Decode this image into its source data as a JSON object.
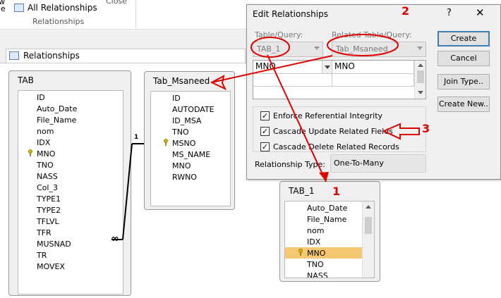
{
  "ribbon": {
    "frag1": "w",
    "frag2": "le",
    "all_relationships": "All Relationships",
    "group": "Relationships",
    "close": "Close"
  },
  "doc_tab": {
    "title": "Relationships"
  },
  "tables": {
    "tab": {
      "title": "TAB",
      "fields": [
        "ID",
        "Auto_Date",
        "File_Name",
        "nom",
        "IDX",
        "MNO",
        "TNO",
        "NASS",
        "Col_3",
        "TYPE1",
        "TYPE2",
        "TFLVL",
        "TFR",
        "MUSNAD",
        "TR",
        "MOVEX"
      ],
      "key_field": "MNO"
    },
    "tab_msaneed": {
      "title": "Tab_Msaneed",
      "fields": [
        "ID",
        "AUTODATE",
        "ID_MSA",
        "TNO",
        "MSNO",
        "MS_NAME",
        "MNO",
        "RWNO"
      ],
      "key_field": "MSNO"
    },
    "tab_1": {
      "title": "TAB_1",
      "fields": [
        "Auto_Date",
        "File_Name",
        "nom",
        "IDX",
        "MNO",
        "TNO",
        "NASS"
      ],
      "key_field": "MNO",
      "selected": "MNO"
    }
  },
  "join_labels": {
    "one": "1",
    "many": "∞"
  },
  "dialog": {
    "title": "Edit Relationships",
    "help": "?",
    "close": "✕",
    "table_query_label": "Table/Query:",
    "table_query_value": "TAB_1",
    "related_label": "Related Table/Query:",
    "related_value": "Tab_Msaneed",
    "grid_left": "MNO",
    "grid_right": "MNO",
    "enforce_label": "Enforce Referential Integrity",
    "cascade_update_label": "Cascade Update Related Fields",
    "cascade_delete_label": "Cascade Delete Related Records",
    "relationship_type_label": "Relationship Type:",
    "relationship_type_value": "One-To-Many",
    "buttons": {
      "create": "Create",
      "cancel": "Cancel",
      "join_type": "Join Type..",
      "create_new": "Create New.."
    }
  },
  "annotations": {
    "n1": "1",
    "n2": "2",
    "n3": "3"
  }
}
